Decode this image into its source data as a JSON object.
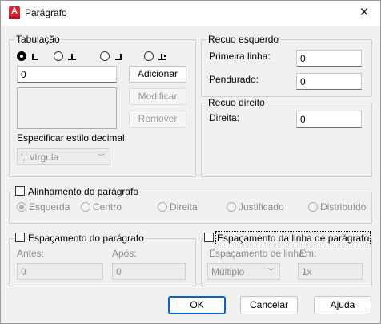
{
  "window": {
    "title": "Parágrafo",
    "close_glyph": "✕",
    "app_icon_letter": "A"
  },
  "tabs_group": {
    "title": "Tabulação",
    "tab_value": "0",
    "add": "Adicionar",
    "modify": "Modificar",
    "remove": "Remover",
    "decimal_label": "Especificar estilo decimal:",
    "decimal_value": "',' vírgula"
  },
  "left_indent": {
    "title": "Recuo esquerdo",
    "first_line_label": "Primeira linha:",
    "first_line_value": "0",
    "hanging_label": "Pendurado:",
    "hanging_value": "0"
  },
  "right_indent": {
    "title": "Recuo direito",
    "right_label": "Direita:",
    "right_value": "0"
  },
  "alignment": {
    "label": "Alinhamento do parágrafo",
    "options": [
      "Esquerda",
      "Centro",
      "Direita",
      "Justificado",
      "Distribuído"
    ]
  },
  "para_spacing": {
    "label": "Espaçamento do parágrafo",
    "before_label": "Antes:",
    "before_value": "0",
    "after_label": "Após:",
    "after_value": "0"
  },
  "line_spacing": {
    "label": "Espaçamento da linha de parágrafo",
    "spacing_label": "Espaçamento de linha:",
    "spacing_value": "Múltiplo",
    "at_label": "Em:",
    "at_value": "1x"
  },
  "buttons": {
    "ok": "OK",
    "cancel": "Cancelar",
    "help": "Ajuda"
  }
}
